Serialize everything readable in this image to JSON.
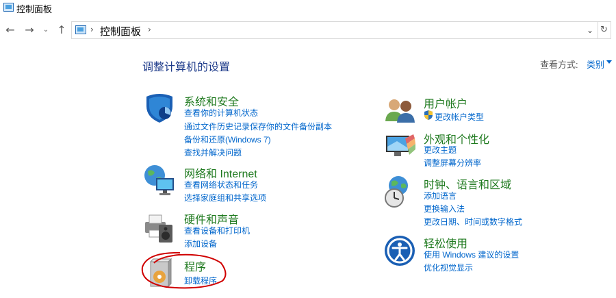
{
  "window": {
    "title": "控制面板"
  },
  "address": {
    "crumb": "控制面板"
  },
  "page": {
    "heading": "调整计算机的设置",
    "view_by_label": "查看方式:",
    "view_by_value": "类别"
  },
  "categories": {
    "security": {
      "title": "系统和安全",
      "links": [
        "查看你的计算机状态",
        "通过文件历史记录保存你的文件备份副本",
        "备份和还原(Windows 7)",
        "查找并解决问题"
      ]
    },
    "network": {
      "title": "网络和 Internet",
      "links": [
        "查看网络状态和任务",
        "选择家庭组和共享选项"
      ]
    },
    "hardware": {
      "title": "硬件和声音",
      "links": [
        "查看设备和打印机",
        "添加设备"
      ]
    },
    "programs": {
      "title": "程序",
      "links": [
        "卸载程序"
      ]
    },
    "accounts": {
      "title": "用户帐户",
      "links": [
        "更改帐户类型"
      ]
    },
    "appearance": {
      "title": "外观和个性化",
      "links": [
        "更改主题",
        "调整屏幕分辨率"
      ]
    },
    "clock": {
      "title": "时钟、语言和区域",
      "links": [
        "添加语言",
        "更换输入法",
        "更改日期、时间或数字格式"
      ]
    },
    "ease": {
      "title": "轻松使用",
      "links": [
        "使用 Windows 建议的设置",
        "优化视觉显示"
      ]
    }
  },
  "colors": {
    "category_title": "#1f7a1f",
    "link": "#0066cc",
    "heading": "#1e3b8a",
    "annotation": "#d00000"
  }
}
